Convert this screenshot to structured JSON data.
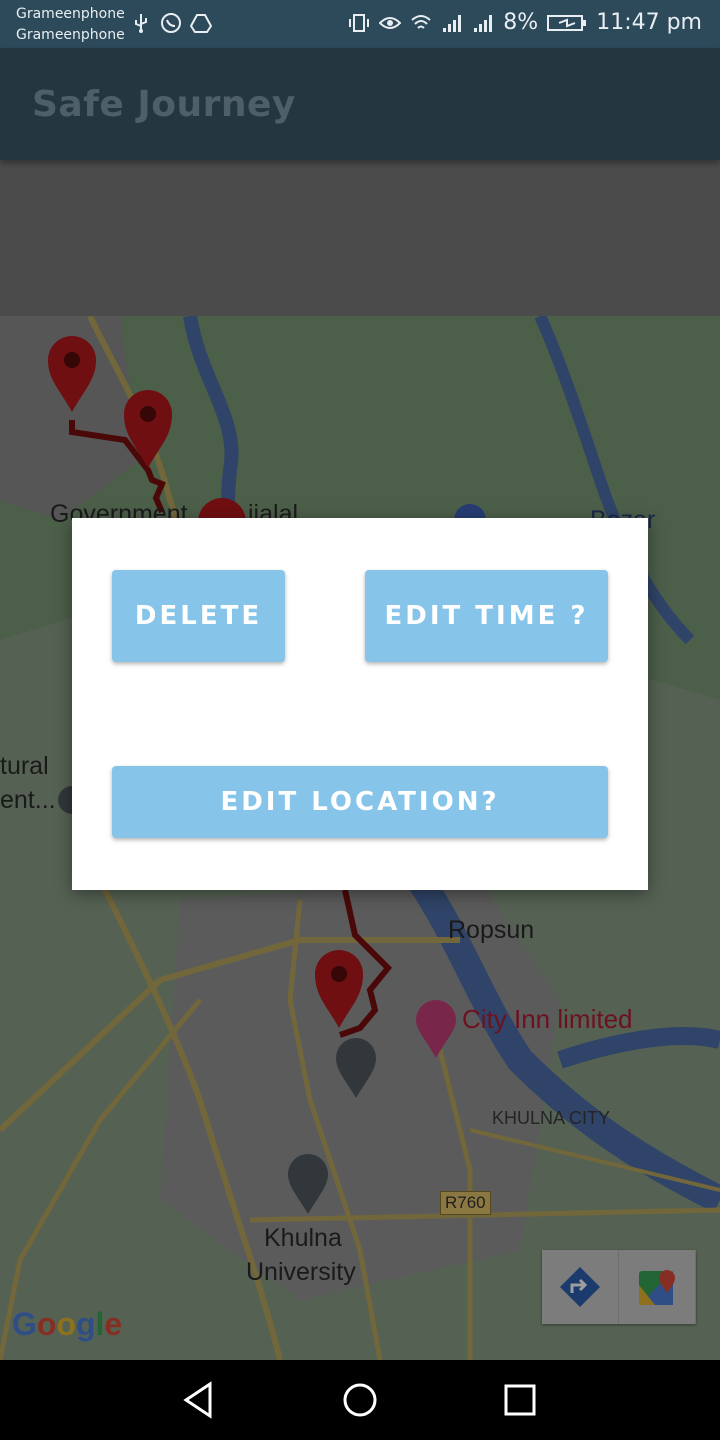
{
  "status_bar": {
    "carrier_1": "Grameenphone",
    "carrier_2": "Grameenphone",
    "battery": "8%",
    "time": "11:47 pm",
    "icons": [
      "usb-icon",
      "whatsapp-icon",
      "drive-icon",
      "vibrate-icon",
      "eye-icon",
      "wifi-icon",
      "signal-icon",
      "signal-icon-2",
      "battery-icon"
    ]
  },
  "app_bar": {
    "title": "Safe Journey"
  },
  "map": {
    "labels": {
      "government": "Government",
      "jialal": "jialal",
      "bazar": "Bazar",
      "tural": "tural",
      "ent": "ent...",
      "ropsun": "Ropsun",
      "city_inn": "City Inn limited",
      "khulna_city": "KHULNA CITY",
      "road": "R760",
      "khulna": "Khulna",
      "university": "University"
    },
    "google_logo": "Google",
    "colors": {
      "land": "#7b9a76",
      "land_light": "#8da889",
      "water": "#4d6fa8",
      "road": "#b9a560",
      "route": "#7a0d0d",
      "marker": "#b3191d"
    }
  },
  "dialog": {
    "delete_label": "DELETE",
    "edit_time_label": "EDIT TIME ?",
    "edit_location_label": "EDIT LOCATION?",
    "button_color": "#86c5e9"
  },
  "nav_bar": {
    "back_icon": "back-triangle-icon",
    "home_icon": "home-circle-icon",
    "recents_icon": "recents-square-icon"
  }
}
